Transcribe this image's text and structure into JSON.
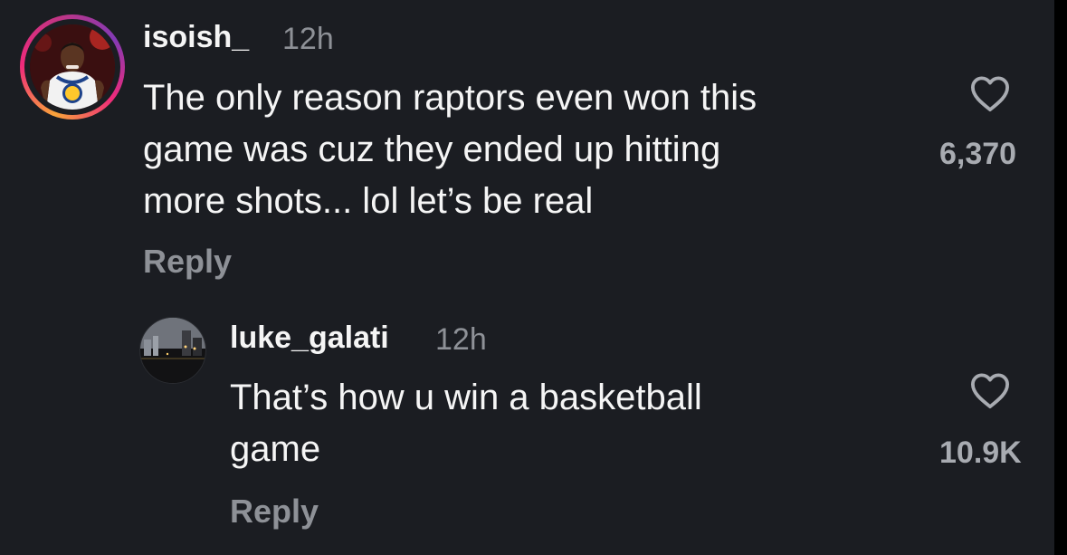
{
  "comments": [
    {
      "username": "isoish_",
      "time": "12h",
      "text_lines": [
        "The only reason raptors even won this",
        "game was cuz they ended up hitting",
        "more shots... lol let’s be real"
      ],
      "reply_label": "Reply",
      "like_count": "6,370",
      "like_icon": "heart-outline-icon",
      "avatar_story_ring": true
    },
    {
      "username": "luke_galati",
      "time": "12h",
      "text_lines": [
        "That’s how u win a basketball",
        "game"
      ],
      "reply_label": "Reply",
      "like_count": "10.9K",
      "like_icon": "heart-outline-icon",
      "avatar_story_ring": false
    }
  ],
  "colors": {
    "background": "#1b1d22",
    "primary_text": "#f5f5f5",
    "secondary_text": "#8e9197",
    "story_ring": [
      "#f9a43a",
      "#ee2a7b",
      "#833ab4"
    ]
  }
}
